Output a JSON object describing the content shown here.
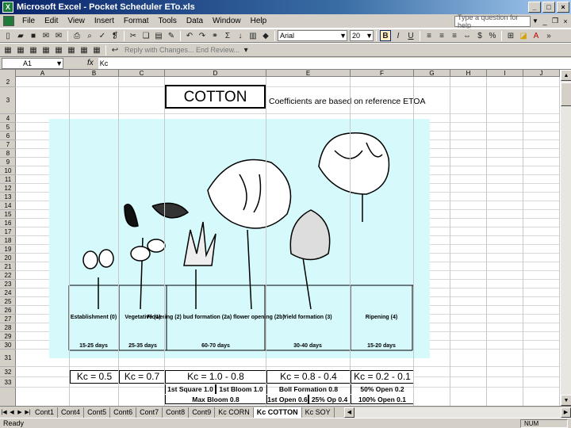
{
  "window": {
    "title": "Microsoft Excel - Pocket Scheduler ETo.xls"
  },
  "menubar": {
    "items": [
      "File",
      "Edit",
      "View",
      "Insert",
      "Format",
      "Tools",
      "Data",
      "Window",
      "Help"
    ],
    "help_placeholder": "Type a question for help"
  },
  "toolbar": {
    "font_name": "Arial",
    "font_size": "20"
  },
  "toolbar2": {
    "reply_text": "Reply with Changes... End Review..."
  },
  "formula_bar": {
    "name_box": "A1",
    "fx_label": "fx",
    "value": "Kc"
  },
  "columns": [
    "A",
    "B",
    "C",
    "D",
    "E",
    "F",
    "G",
    "H",
    "I",
    "J"
  ],
  "rows": [
    "2",
    "3",
    "4",
    "5",
    "6",
    "7",
    "8",
    "9",
    "10",
    "11",
    "12",
    "13",
    "14",
    "15",
    "16",
    "17",
    "18",
    "19",
    "20",
    "21",
    "22",
    "23",
    "24",
    "25",
    "26",
    "27",
    "28",
    "29",
    "30",
    "31",
    "32",
    "33"
  ],
  "sheet": {
    "title": "COTTON",
    "note": "Coefficients are based on reference ETOA",
    "stages": [
      {
        "name": "Establishment (0)",
        "days": "15-25 days"
      },
      {
        "name": "Vegetative (1)",
        "days": "25-35 days"
      },
      {
        "name": "Flowering (2) bud formation (2a) flower opening (2b)",
        "days": "60-70 days"
      },
      {
        "name": "Yield formation (3)",
        "days": "30-40 days"
      },
      {
        "name": "Ripening (4)",
        "days": "15-20 days"
      }
    ],
    "kc": [
      "Kc = 0.5",
      "Kc = 0.7",
      "Kc = 1.0 - 0.8",
      "Kc = 0.8 - 0.4",
      "Kc = 0.2 - 0.1"
    ],
    "sub1": [
      "1st Square 1.0",
      "1st Bloom 1.0",
      "Boll Formation 0.8",
      "50% Open 0.2"
    ],
    "sub2": [
      "Max Bloom 0.8",
      "1st Open 0.6",
      "25% Op 0.4",
      "100% Open 0.1"
    ]
  },
  "tabs": [
    "Cont1",
    "Cont4",
    "Cont5",
    "Cont6",
    "Cont7",
    "Cont8",
    "Cont9",
    "Kc CORN",
    "Kc COTTON",
    "Kc SOY"
  ],
  "active_tab": "Kc COTTON",
  "status": {
    "text": "Ready",
    "num": "NUM"
  }
}
